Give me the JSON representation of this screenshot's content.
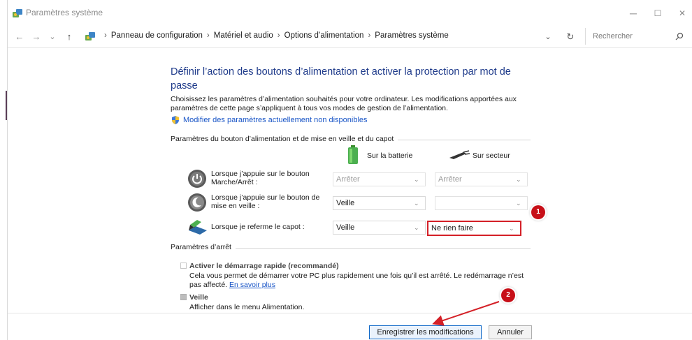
{
  "window": {
    "title": "Paramètres système",
    "minimize": "─",
    "maximize": "☐",
    "close": "✕"
  },
  "nav": {
    "back": "←",
    "forward": "→",
    "recent": "⌄",
    "up": "↑",
    "breadcrumbs": [
      "Panneau de configuration",
      "Matériel et audio",
      "Options d’alimentation",
      "Paramètres système"
    ],
    "separator": "›",
    "dropdown": "⌄",
    "refresh": "↻",
    "search_placeholder": "Rechercher"
  },
  "main": {
    "heading": "Définir l’action des boutons d’alimentation et activer la protection par mot de passe",
    "description": "Choisissez les paramètres d’alimentation souhaités pour votre ordinateur. Les modifications apportées aux paramètres de cette page s’appliquent à tous vos modes de gestion de l’alimentation.",
    "unavailable_link": "Modifier des paramètres actuellement non disponibles"
  },
  "power_group": {
    "title": "Paramètres du bouton d’alimentation et de mise en veille et du capot",
    "col_battery": "Sur la batterie",
    "col_ac": "Sur secteur",
    "rows": [
      {
        "label": "Lorsque j’appuie sur le bouton Marche/Arrêt :",
        "battery": "Arrêter",
        "ac": "Arrêter"
      },
      {
        "label": "Lorsque j’appuie sur le bouton de mise en veille :",
        "battery": "Veille",
        "ac": ""
      },
      {
        "label": "Lorsque je referme le capot :",
        "battery": "Veille",
        "ac": "Ne rien faire"
      }
    ]
  },
  "shutdown_group": {
    "title": "Paramètres d’arrêt",
    "fast_startup_label": "Activer le démarrage rapide (recommandé)",
    "fast_startup_desc": "Cela vous permet de démarrer votre PC plus rapidement une fois qu’il est arrêté. Le redémarrage n’est pas affecté.",
    "learn_more": "En savoir plus",
    "sleep_label": "Veille",
    "sleep_desc": "Afficher dans le menu Alimentation."
  },
  "footer": {
    "save": "Enregistrer les modifications",
    "cancel": "Annuler"
  },
  "annotations": {
    "badge1": "1",
    "badge2": "2",
    "color": "#c70f18"
  }
}
